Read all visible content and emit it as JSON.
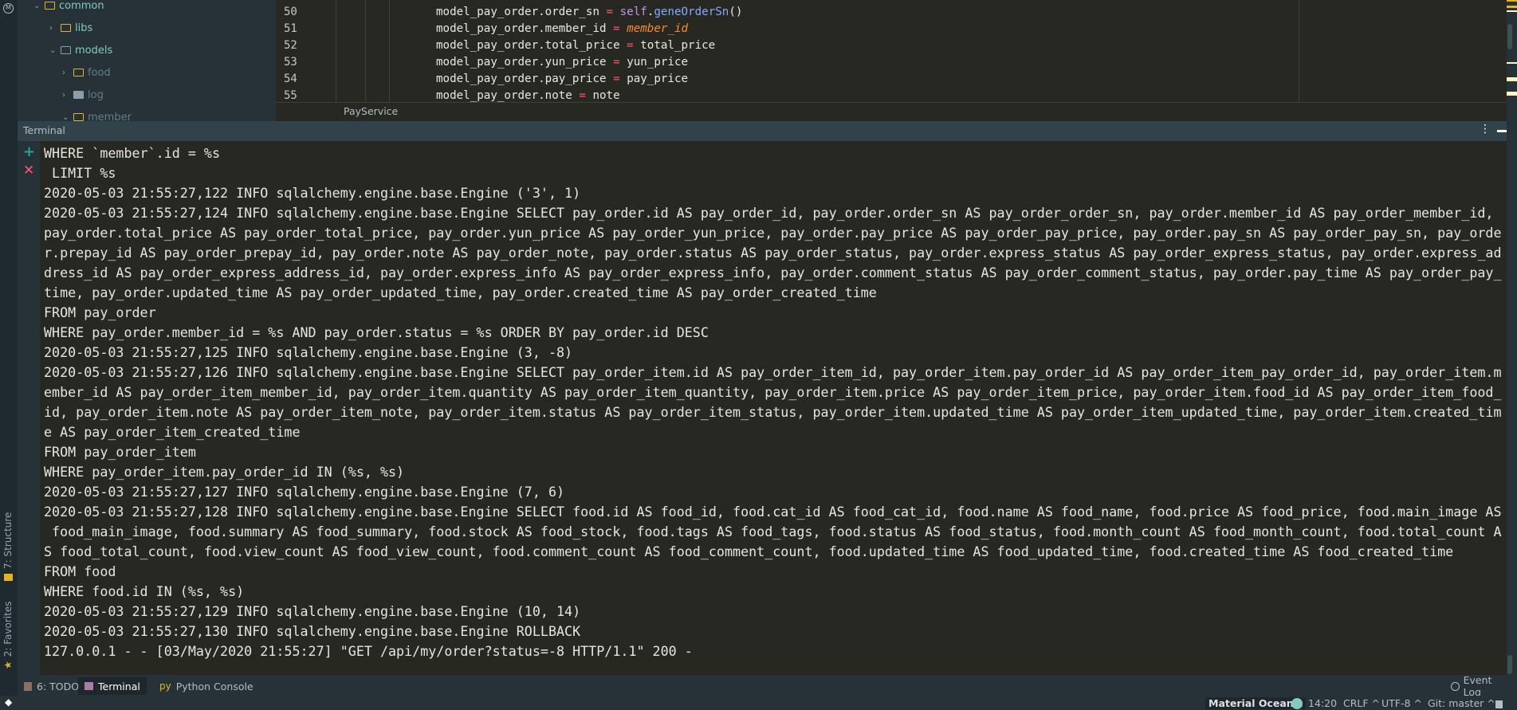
{
  "project_tree": {
    "items": [
      {
        "label": "common",
        "expanded": true,
        "color": "#80cbc4"
      },
      {
        "label": "libs",
        "expanded": false,
        "color": "#80cbc4"
      },
      {
        "label": "models",
        "expanded": true,
        "color": "#80cbc4"
      },
      {
        "label": "food",
        "expanded": false,
        "color": "#607d8b"
      },
      {
        "label": "log",
        "expanded": false,
        "color": "#607d8b"
      },
      {
        "label": "member",
        "expanded": true,
        "color": "#607d8b"
      }
    ]
  },
  "editor": {
    "lines": [
      {
        "num": "50",
        "parts": [
          [
            "model_pay_order.order_sn ",
            "#e8e8e0"
          ],
          [
            "= ",
            "#ff5370"
          ],
          [
            "self",
            "#c792ea"
          ],
          [
            ".",
            "#e8e8e0"
          ],
          [
            "geneOrderSn",
            "#82aaff"
          ],
          [
            "()",
            "#e8e8e0"
          ]
        ]
      },
      {
        "num": "51",
        "parts": [
          [
            "model_pay_order.member_id ",
            "#e8e8e0"
          ],
          [
            "= ",
            "#ff5370"
          ],
          [
            "member_id",
            "#f78c2a"
          ]
        ]
      },
      {
        "num": "52",
        "parts": [
          [
            "model_pay_order.total_price ",
            "#e8e8e0"
          ],
          [
            "= ",
            "#ff5370"
          ],
          [
            "total_price",
            "#e8e8e0"
          ]
        ]
      },
      {
        "num": "53",
        "parts": [
          [
            "model_pay_order.yun_price ",
            "#e8e8e0"
          ],
          [
            "= ",
            "#ff5370"
          ],
          [
            "yun_price",
            "#e8e8e0"
          ]
        ]
      },
      {
        "num": "54",
        "parts": [
          [
            "model_pay_order.pay_price ",
            "#e8e8e0"
          ],
          [
            "= ",
            "#ff5370"
          ],
          [
            "pay_price",
            "#e8e8e0"
          ]
        ]
      },
      {
        "num": "55",
        "parts": [
          [
            "model_pay_order.note ",
            "#e8e8e0"
          ],
          [
            "= ",
            "#ff5370"
          ],
          [
            "note",
            "#e8e8e0"
          ]
        ]
      }
    ],
    "breadcrumb": "PayService"
  },
  "terminal": {
    "title": "Terminal",
    "lines": [
      "WHERE `member`.id = %s",
      " LIMIT %s",
      "2020-05-03 21:55:27,122 INFO sqlalchemy.engine.base.Engine ('3', 1)",
      "2020-05-03 21:55:27,124 INFO sqlalchemy.engine.base.Engine SELECT pay_order.id AS pay_order_id, pay_order.order_sn AS pay_order_order_sn, pay_order.member_id AS pay_order_member_id,",
      "pay_order.total_price AS pay_order_total_price, pay_order.yun_price AS pay_order_yun_price, pay_order.pay_price AS pay_order_pay_price, pay_order.pay_sn AS pay_order_pay_sn, pay_orde",
      "r.prepay_id AS pay_order_prepay_id, pay_order.note AS pay_order_note, pay_order.status AS pay_order_status, pay_order.express_status AS pay_order_express_status, pay_order.express_ad",
      "dress_id AS pay_order_express_address_id, pay_order.express_info AS pay_order_express_info, pay_order.comment_status AS pay_order_comment_status, pay_order.pay_time AS pay_order_pay_",
      "time, pay_order.updated_time AS pay_order_updated_time, pay_order.created_time AS pay_order_created_time",
      "FROM pay_order",
      "WHERE pay_order.member_id = %s AND pay_order.status = %s ORDER BY pay_order.id DESC",
      "2020-05-03 21:55:27,125 INFO sqlalchemy.engine.base.Engine (3, -8)",
      "2020-05-03 21:55:27,126 INFO sqlalchemy.engine.base.Engine SELECT pay_order_item.id AS pay_order_item_id, pay_order_item.pay_order_id AS pay_order_item_pay_order_id, pay_order_item.m",
      "ember_id AS pay_order_item_member_id, pay_order_item.quantity AS pay_order_item_quantity, pay_order_item.price AS pay_order_item_price, pay_order_item.food_id AS pay_order_item_food_",
      "id, pay_order_item.note AS pay_order_item_note, pay_order_item.status AS pay_order_item_status, pay_order_item.updated_time AS pay_order_item_updated_time, pay_order_item.created_tim",
      "e AS pay_order_item_created_time",
      "FROM pay_order_item",
      "WHERE pay_order_item.pay_order_id IN (%s, %s)",
      "2020-05-03 21:55:27,127 INFO sqlalchemy.engine.base.Engine (7, 6)",
      "2020-05-03 21:55:27,128 INFO sqlalchemy.engine.base.Engine SELECT food.id AS food_id, food.cat_id AS food_cat_id, food.name AS food_name, food.price AS food_price, food.main_image AS",
      " food_main_image, food.summary AS food_summary, food.stock AS food_stock, food.tags AS food_tags, food.status AS food_status, food.month_count AS food_month_count, food.total_count A",
      "S food_total_count, food.view_count AS food_view_count, food.comment_count AS food_comment_count, food.updated_time AS food_updated_time, food.created_time AS food_created_time",
      "FROM food",
      "WHERE food.id IN (%s, %s)",
      "2020-05-03 21:55:27,129 INFO sqlalchemy.engine.base.Engine (10, 14)",
      "2020-05-03 21:55:27,130 INFO sqlalchemy.engine.base.Engine ROLLBACK",
      "127.0.0.1 - - [03/May/2020 21:55:27] \"GET /api/my/order?status=-8 HTTP/1.1\" 200 -"
    ]
  },
  "side_tabs": {
    "structure": "7: Structure",
    "favorites": "2: Favorites"
  },
  "bottom_tabs": [
    {
      "label": "6: TODO",
      "icon": "todo-icon"
    },
    {
      "label": "Terminal",
      "icon": "terminal-icon",
      "active": true
    },
    {
      "label": "Python Console",
      "icon": "python-icon"
    }
  ],
  "event_log": "Event Log",
  "status_bar": {
    "theme": "Material Oceanic",
    "position": "14:20",
    "line_sep": "CRLF ^",
    "encoding": "UTF-8 ^",
    "git": "Git: master ^"
  },
  "colors": {
    "accent": "#80cbc4",
    "add": "#26a69a",
    "close": "#ff5370"
  }
}
